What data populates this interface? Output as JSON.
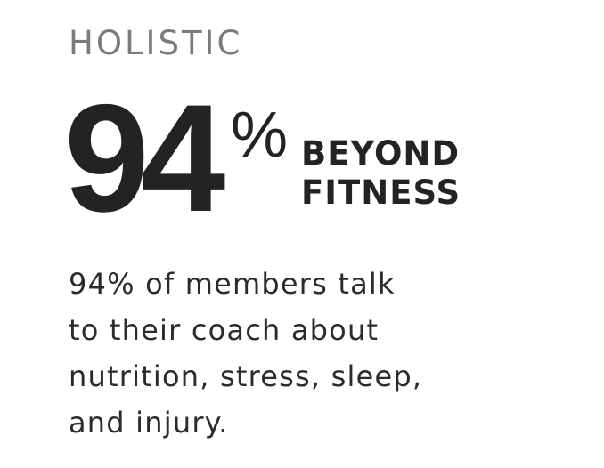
{
  "eyebrow": "HOLISTIC",
  "stat": {
    "number": "94",
    "percent_sign": "%",
    "label_lines": [
      "BEYOND",
      "FITNESS"
    ]
  },
  "description_lines": [
    "94% of members talk",
    "to their coach about",
    "nutrition, stress, sleep,",
    "and injury."
  ]
}
